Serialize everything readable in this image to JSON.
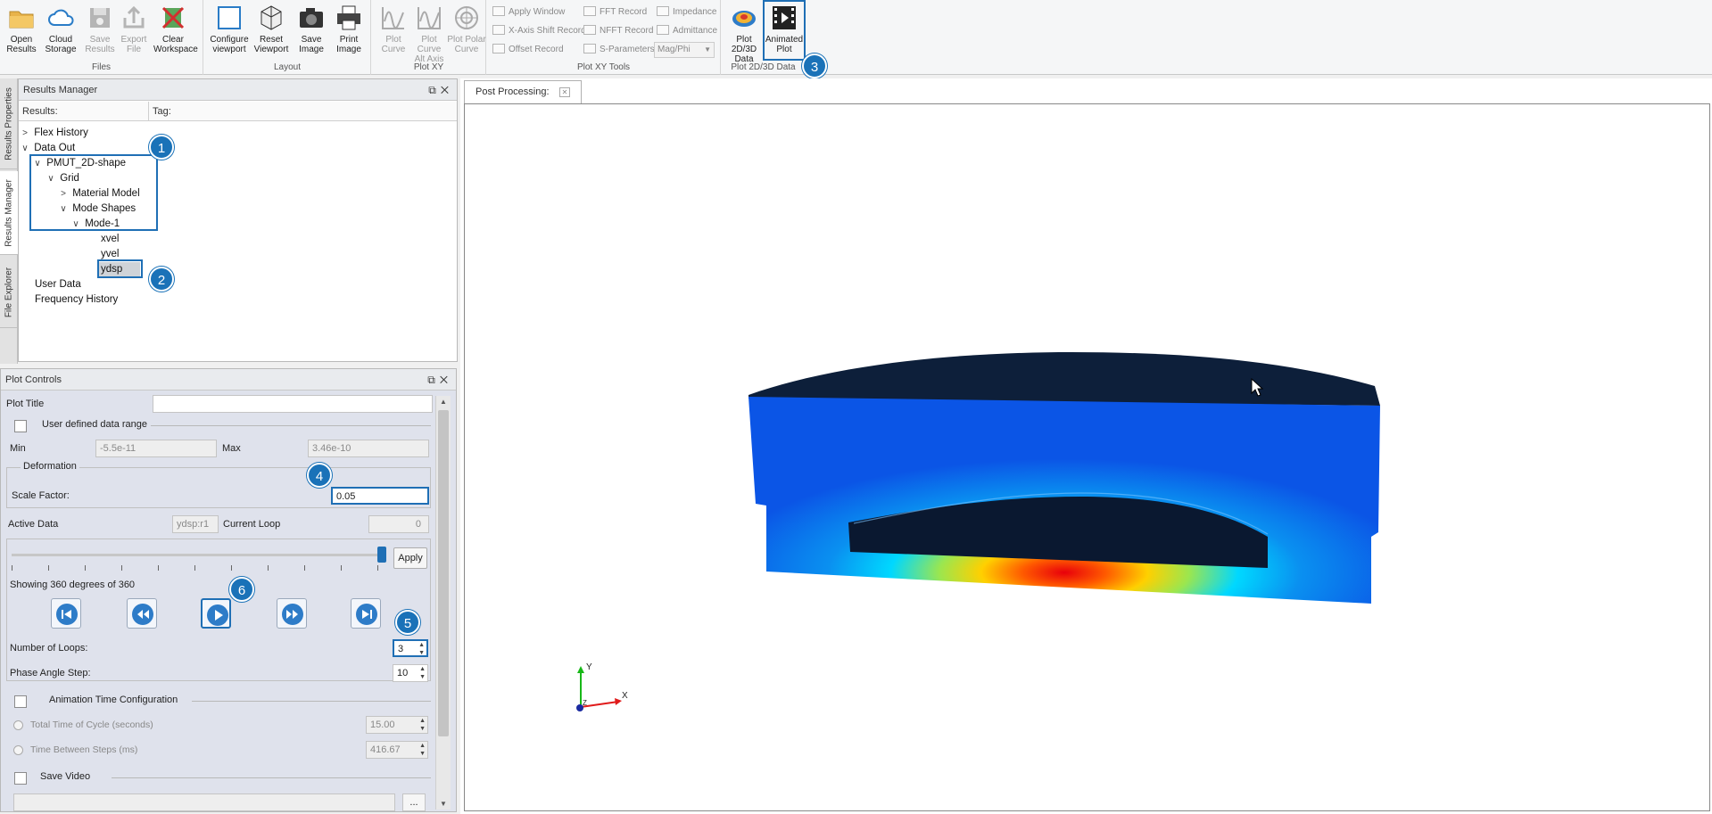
{
  "ribbon": {
    "files": {
      "group_label": "Files",
      "open_results": "Open\nResults",
      "cloud_storage": "Cloud\nStorage",
      "save_results": "Save\nResults",
      "export_file": "Export\nFile",
      "clear_workspace": "Clear\nWorkspace"
    },
    "layout": {
      "group_label": "Layout",
      "configure_viewport": "Configure\nviewport",
      "reset_viewport": "Reset\nViewport",
      "save_image": "Save\nImage",
      "print_image": "Print\nImage"
    },
    "plot_xy": {
      "group_label": "Plot XY",
      "plot_curve": "Plot\nCurve",
      "plot_curve_alt": "Plot Curve\nAlt Axis",
      "plot_polar": "Plot Polar\nCurve"
    },
    "plot_xy_tools": {
      "group_label": "Plot XY Tools",
      "apply_window": "Apply Window",
      "x_axis_shift": "X-Axis Shift Record",
      "offset_record": "Offset Record",
      "fft_record": "FFT Record",
      "nfft_record": "NFFT Record",
      "s_parameters": "S-Parameters",
      "impedance": "Impedance",
      "admittance": "Admittance",
      "mag_phi": "Mag/Phi"
    },
    "plot_2d3d": {
      "group_label": "Plot 2D/3D Data",
      "plot_2d3d_data": "Plot 2D/3D\nData",
      "animated_plot": "Animated\nPlot"
    }
  },
  "callouts": [
    "1",
    "2",
    "3",
    "4",
    "5",
    "6"
  ],
  "side_tabs": [
    "Results Properties",
    "Results Manager",
    "File Explorer"
  ],
  "results_manager": {
    "title": "Results Manager",
    "col_results": "Results:",
    "col_tag": "Tag:",
    "tree": {
      "flex_history": "Flex History",
      "data_out": "Data Out",
      "pmut": "PMUT_2D-shape",
      "grid": "Grid",
      "material_model": "Material Model",
      "mode_shapes": "Mode Shapes",
      "mode1": "Mode-1",
      "xvel": "xvel",
      "yvel": "yvel",
      "ydsp": "ydsp",
      "user_data": "User Data",
      "frequency_history": "Frequency History"
    }
  },
  "plot_controls": {
    "title": "Plot Controls",
    "plot_title_label": "Plot Title",
    "plot_title_value": "",
    "user_range_label": "User defined data range",
    "min_label": "Min",
    "min_value": "-5.5e-11",
    "max_label": "Max",
    "max_value": "3.46e-10",
    "deformation_label": "Deformation",
    "scale_factor_label": "Scale Factor:",
    "scale_factor_value": "0.05",
    "active_data_label": "Active Data",
    "active_data_value": "ydsp:r1",
    "current_loop_label": "Current Loop",
    "current_loop_value": "0",
    "slider_fraction": 1.0,
    "apply_label": "Apply",
    "showing_text": "Showing 360 degrees of 360",
    "loops_label": "Number of Loops:",
    "loops_value": "3",
    "phase_step_label": "Phase Angle Step:",
    "phase_step_value": "10",
    "anim_time_label": "Animation Time Configuration",
    "total_time_label": "Total Time of Cycle (seconds)",
    "total_time_value": "15.00",
    "time_between_label": "Time Between Steps (ms)",
    "time_between_value": "416.67",
    "save_video_label": "Save Video",
    "browse_label": "..."
  },
  "viewer": {
    "tab_label": "Post Processing:",
    "axis_y": "Y",
    "axis_x": "X",
    "axis_z": "Z"
  },
  "colors": {
    "accent": "#1f6fb5",
    "callout": "#1a72b8",
    "panel_bg": "#dfe2ec"
  }
}
